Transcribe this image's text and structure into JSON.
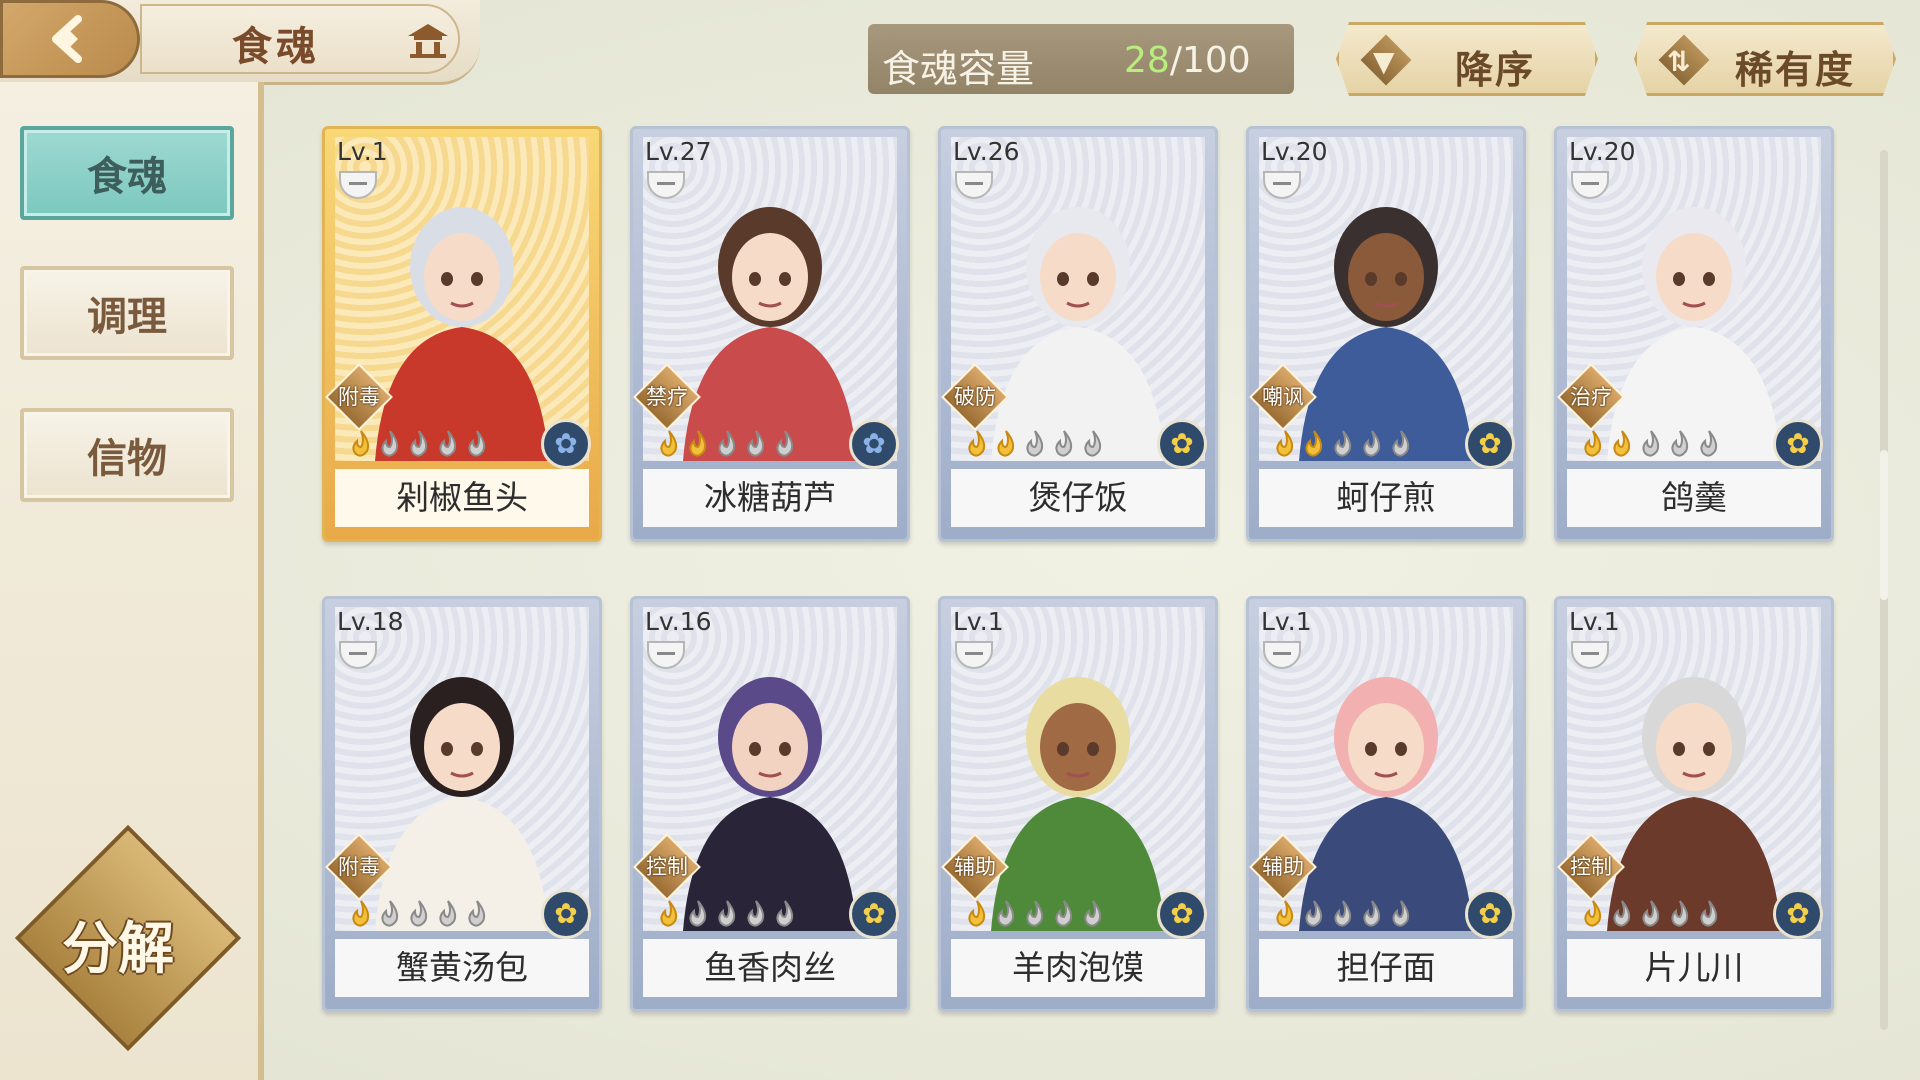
{
  "header": {
    "title": "食魂",
    "capacity_label": "食魂容量",
    "capacity_current": "28",
    "capacity_total": "/100",
    "sort_order_label": "降序",
    "sort_by_label": "稀有度"
  },
  "sidebar": {
    "items": [
      {
        "label": "食魂",
        "active": true
      },
      {
        "label": "调理",
        "active": false
      },
      {
        "label": "信物",
        "active": false
      }
    ],
    "decompose_label": "分解"
  },
  "cards": [
    {
      "level": "Lv.1",
      "role": "附毒",
      "name": "剁椒鱼头",
      "stars": 1,
      "emblem": "blue"
    },
    {
      "level": "Lv.27",
      "role": "禁疗",
      "name": "冰糖葫芦",
      "stars": 2,
      "emblem": "blue"
    },
    {
      "level": "Lv.26",
      "role": "破防",
      "name": "煲仔饭",
      "stars": 2,
      "emblem": "gold"
    },
    {
      "level": "Lv.20",
      "role": "嘲讽",
      "name": "蚵仔煎",
      "stars": 2,
      "emblem": "gold"
    },
    {
      "level": "Lv.20",
      "role": "治疗",
      "name": "鸽羹",
      "stars": 2,
      "emblem": "gold"
    },
    {
      "level": "Lv.18",
      "role": "附毒",
      "name": "蟹黄汤包",
      "stars": 1,
      "emblem": "gold"
    },
    {
      "level": "Lv.16",
      "role": "控制",
      "name": "鱼香肉丝",
      "stars": 1,
      "emblem": "gold"
    },
    {
      "level": "Lv.1",
      "role": "辅助",
      "name": "羊肉泡馍",
      "stars": 1,
      "emblem": "gold"
    },
    {
      "level": "Lv.1",
      "role": "辅助",
      "name": "担仔面",
      "stars": 1,
      "emblem": "gold"
    },
    {
      "level": "Lv.1",
      "role": "控制",
      "name": "片儿川",
      "stars": 1,
      "emblem": "gold"
    }
  ],
  "colors": {
    "accent_active": "#7cc8bf",
    "capacity_current": "#b7ee7c",
    "gold": "#caa864"
  }
}
